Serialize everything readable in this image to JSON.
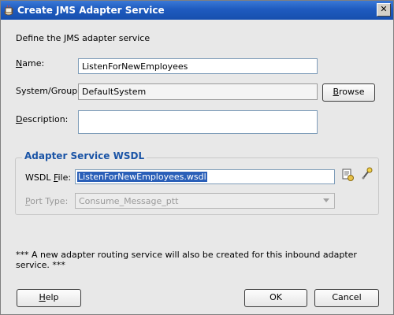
{
  "window": {
    "title": "Create JMS Adapter Service",
    "close_label": "✕"
  },
  "intro_text": "Define the JMS adapter service",
  "form": {
    "name_label_prefix": "",
    "name_label_ul": "N",
    "name_label_rest": "ame:",
    "name_value": "ListenForNewEmployees",
    "system_label": "System/Group:",
    "system_value": "DefaultSystem",
    "browse_label_prefix": "",
    "browse_label_ul": "B",
    "browse_label_rest": "rowse",
    "description_label_ul": "D",
    "description_label_rest": "escription:",
    "description_value": ""
  },
  "wsdl_group": {
    "title": "Adapter Service WSDL",
    "wsdl_label_prefix": "WSDL ",
    "wsdl_label_ul": "F",
    "wsdl_label_rest": "ile:",
    "wsdl_value": "ListenForNewEmployees.wsdl",
    "port_label_prefix": "",
    "port_label_ul": "P",
    "port_label_rest": "ort Type:",
    "port_value": "Consume_Message_ptt"
  },
  "note_text": "*** A new adapter routing service will also be created for this inbound adapter service. ***",
  "buttons": {
    "help_ul": "H",
    "help_rest": "elp",
    "ok": "OK",
    "cancel": "Cancel"
  }
}
